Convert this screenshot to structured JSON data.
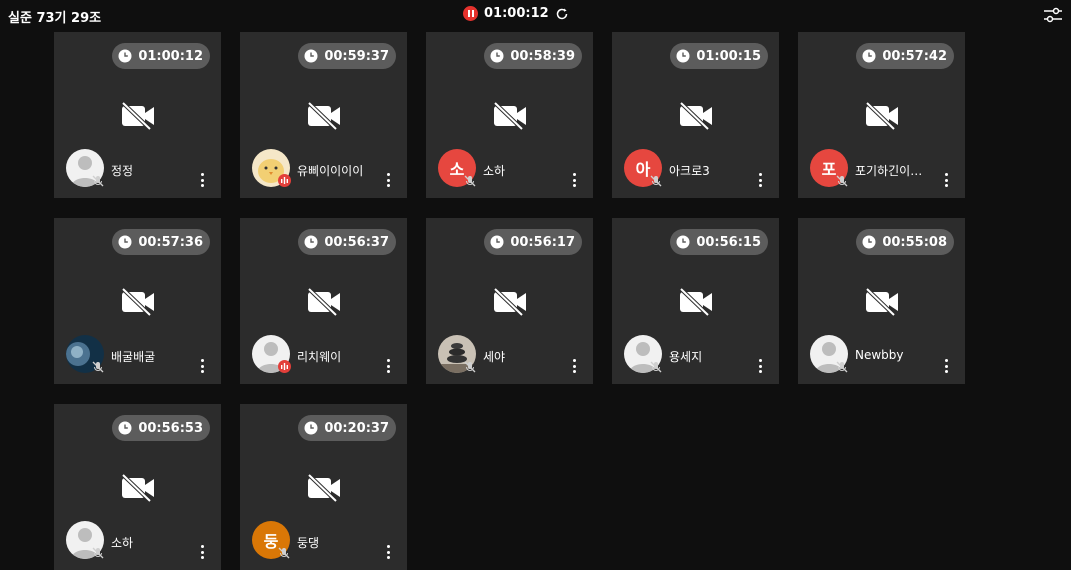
{
  "header": {
    "room_title": "실준 73기 29조",
    "session_timer": "01:00:12"
  },
  "participants": [
    {
      "name": "정정",
      "time": "01:00:12",
      "avatar": "default"
    },
    {
      "name": "유삐이이이이",
      "time": "00:59:37",
      "avatar": "chick"
    },
    {
      "name": "소하",
      "time": "00:58:39",
      "avatar": "letter",
      "letter": "소",
      "color": "#e6473f"
    },
    {
      "name": "아크로3",
      "time": "01:00:15",
      "avatar": "letter",
      "letter": "아",
      "color": "#e6473f"
    },
    {
      "name": "포기하긴이…",
      "time": "00:57:42",
      "avatar": "letter",
      "letter": "포",
      "color": "#e6473f"
    },
    {
      "name": "배굴배굴",
      "time": "00:57:36",
      "avatar": "globe"
    },
    {
      "name": "리치웨이",
      "time": "00:56:37",
      "avatar": "default"
    },
    {
      "name": "세야",
      "time": "00:56:17",
      "avatar": "stones"
    },
    {
      "name": "용세지",
      "time": "00:56:15",
      "avatar": "default"
    },
    {
      "name": "Newbby",
      "time": "00:55:08",
      "avatar": "default"
    },
    {
      "name": "소하",
      "time": "00:56:53",
      "avatar": "default"
    },
    {
      "name": "둥댕",
      "time": "00:20:37",
      "avatar": "letter",
      "letter": "둥",
      "color": "#d97706"
    }
  ],
  "icons": {
    "pause": "pause-icon",
    "refresh": "refresh-icon",
    "settings": "sliders-icon",
    "clock": "clock-icon",
    "camera_off": "camera-off-icon",
    "mic_off": "mic-off-icon",
    "live": "live-audio-icon",
    "more": "more-vertical-icon"
  }
}
